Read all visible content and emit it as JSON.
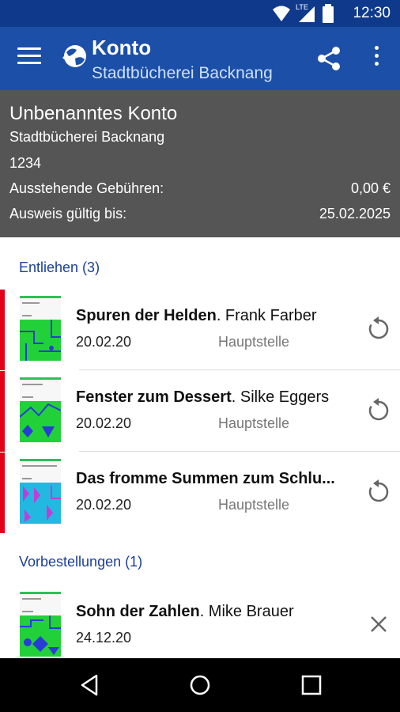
{
  "status_bar": {
    "time": "12:30",
    "network_label": "LTE",
    "icons": [
      "wifi-icon",
      "signal-icon",
      "battery-icon"
    ]
  },
  "app_bar": {
    "title": "Konto",
    "subtitle": "Stadtbücherei Backnang",
    "icons": [
      "menu-icon",
      "library-logo-icon",
      "share-icon",
      "more-vert-icon"
    ]
  },
  "account": {
    "name": "Unbenanntes Konto",
    "library": "Stadtbücherei Backnang",
    "number": "1234",
    "fees_label": "Ausstehende Gebühren:",
    "fees_value": "0,00 €",
    "valid_label": "Ausweis gültig bis:",
    "valid_value": "25.02.2025"
  },
  "lent": {
    "header": "Entliehen (3)",
    "items": [
      {
        "title": "Spuren der Helden",
        "author": ". Frank Farber",
        "date": "20.02.20",
        "branch": "Hauptstelle",
        "action_icon": "renew-icon"
      },
      {
        "title": "Fenster zum Dessert",
        "author": ". Silke Eggers",
        "date": "20.02.20",
        "branch": "Hauptstelle",
        "action_icon": "renew-icon"
      },
      {
        "title": "Das fromme Summen zum Schlu...",
        "author": "",
        "date": "20.02.20",
        "branch": "Hauptstelle",
        "action_icon": "renew-icon"
      }
    ]
  },
  "reservations": {
    "header": "Vorbestellungen (1)",
    "items": [
      {
        "title": "Sohn der Zahlen",
        "author": ". Mike Brauer",
        "date": "24.12.20",
        "action_icon": "close-icon"
      }
    ]
  },
  "colors": {
    "status_bar": "#0f3a8c",
    "app_bar": "#1b4fa8",
    "account_bg": "#555555",
    "accent": "#1b3f99",
    "overdue_marker": "#e3001b"
  },
  "nav_bar": {
    "icons": [
      "back-icon",
      "home-icon",
      "recents-icon"
    ]
  }
}
